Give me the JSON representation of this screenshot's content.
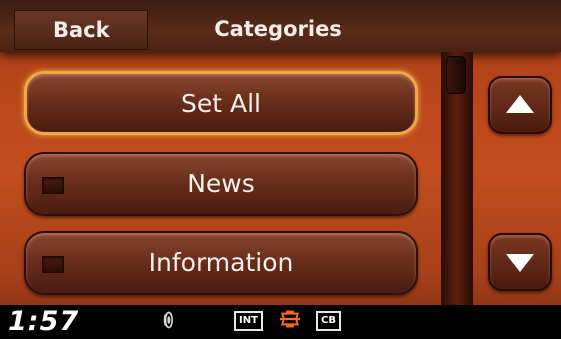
{
  "header": {
    "back_label": "Back",
    "title": "Categories"
  },
  "list": {
    "items": [
      {
        "label": "Set All",
        "selected": true,
        "has_checkbox": false
      },
      {
        "label": "News",
        "selected": false,
        "has_checkbox": true,
        "checked": false
      },
      {
        "label": "Information",
        "selected": false,
        "has_checkbox": true,
        "checked": false
      }
    ]
  },
  "scroll": {
    "up_icon": "arrow-up-icon",
    "down_icon": "arrow-down-icon"
  },
  "status": {
    "time": "1:57",
    "indicators": [
      "INT",
      "CB"
    ],
    "volume_icon": "volume-icon",
    "logo_icon": "harley-logo-icon"
  },
  "colors": {
    "background": "#b5441a",
    "selected_border": "#f0a840",
    "header": "#4a2212",
    "status_bar": "#000000"
  }
}
